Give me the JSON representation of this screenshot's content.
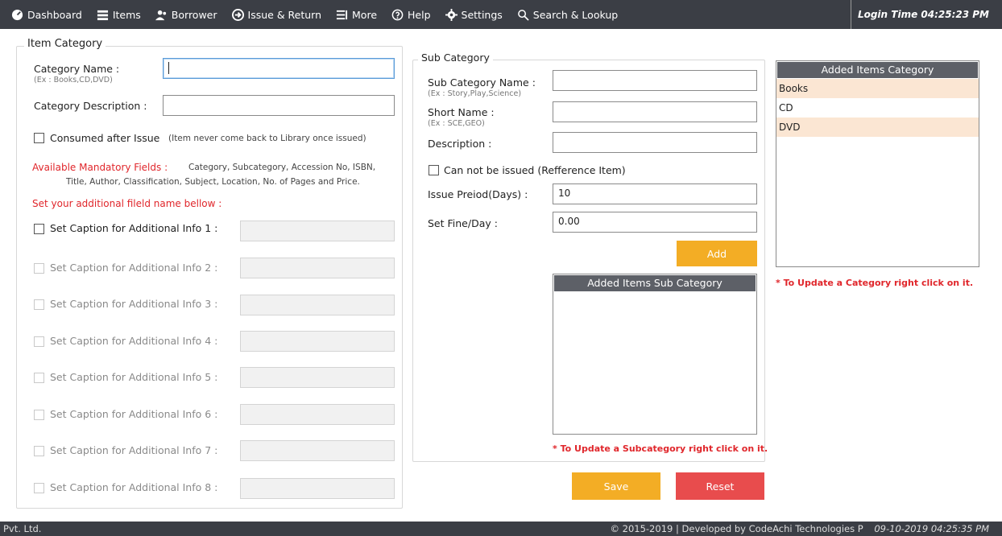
{
  "nav": {
    "items": [
      {
        "label": "Dashboard",
        "icon": "dashboard-icon"
      },
      {
        "label": "Items",
        "icon": "items-icon"
      },
      {
        "label": "Borrower",
        "icon": "borrower-icon"
      },
      {
        "label": "Issue & Return",
        "icon": "issue-return-icon"
      },
      {
        "label": "More",
        "icon": "more-icon"
      },
      {
        "label": "Help",
        "icon": "help-icon"
      },
      {
        "label": "Settings",
        "icon": "gear-icon"
      },
      {
        "label": "Search & Lookup",
        "icon": "search-icon"
      }
    ],
    "login_time": "Login Time 04:25:23 PM"
  },
  "item_category": {
    "title": "Item Category",
    "category_name_label": "Category Name :",
    "category_name_hint": "(Ex : Books,CD,DVD)",
    "category_name_value": "",
    "category_description_label": "Category Description :",
    "category_description_value": "",
    "consumed_label": "Consumed after Issue",
    "consumed_note": "(Item never come back to Library once issued)",
    "mandatory_label": "Available Mandatory Fields :",
    "mandatory_text_1": "Category, Subcategory, Accession No, ISBN,",
    "mandatory_text_2": "Title, Author, Classification, Subject, Location, No. of Pages and Price.",
    "additional_heading": "Set your additional fileld name bellow :",
    "captions": [
      "Set Caption for Additional Info 1 :",
      "Set Caption for Additional Info 2 :",
      "Set Caption for Additional Info 3 :",
      "Set Caption for Additional Info 4 :",
      "Set Caption for Additional Info 5 :",
      "Set Caption for Additional Info 6 :",
      "Set Caption for Additional Info 7 :",
      "Set Caption for Additional Info 8 :"
    ]
  },
  "sub_category": {
    "title": "Sub Category",
    "name_label": "Sub Category Name :",
    "name_hint": "(Ex : Story,Play,Science)",
    "name_value": "",
    "short_label": "Short Name :",
    "short_hint": "(Ex : SCE,GEO)",
    "short_value": "",
    "description_label": "Description :",
    "description_value": "",
    "not_issued_label": "Can not be issued (Refference Item)",
    "issue_period_label": "Issue Preiod(Days) :",
    "issue_period_value": "10",
    "fine_label": "Set Fine/Day :",
    "fine_value": "0.00",
    "add_button": "Add",
    "list_header": "Added Items Sub Category",
    "note": "* To Update a Subcategory right click on it."
  },
  "added_category": {
    "header": "Added Items Category",
    "items": [
      "Books",
      "CD",
      "DVD"
    ],
    "note": "* To Update a Category right click on it."
  },
  "actions": {
    "save": "Save",
    "reset": "Reset"
  },
  "footer": {
    "left": "Pvt. Ltd.",
    "right": "© 2015-2019 | Developed by CodeAchi Technologies P",
    "timestamp": "09-10-2019 04:25:35 PM"
  },
  "colors": {
    "topbar": "#3b3e45",
    "accent_orange": "#f3ad25",
    "accent_red": "#e84c4d",
    "warning_text": "#e0262b",
    "list_alt_row": "#fbe6d3"
  }
}
